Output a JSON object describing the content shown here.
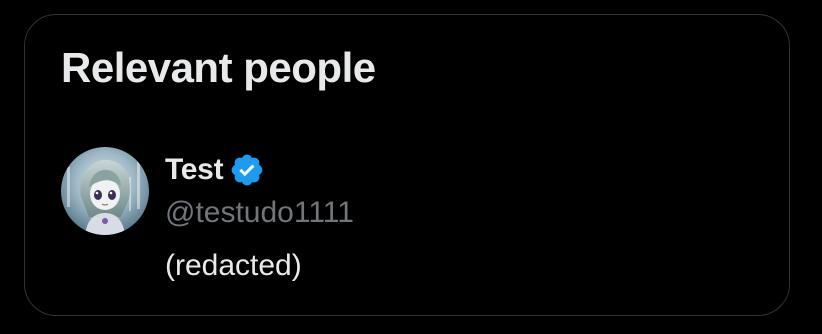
{
  "colors": {
    "background": "#000000",
    "border": "#2f3336",
    "primary_text": "#e7e9ea",
    "secondary_text": "#71767b",
    "verified_blue": "#1d9bf0"
  },
  "card": {
    "title": "Relevant people",
    "person": {
      "avatar_icon": "anime-avatar",
      "display_name": "Test",
      "verified": true,
      "verified_icon": "verified-badge-icon",
      "handle": "@testudo1111",
      "bio": "(redacted)"
    }
  }
}
